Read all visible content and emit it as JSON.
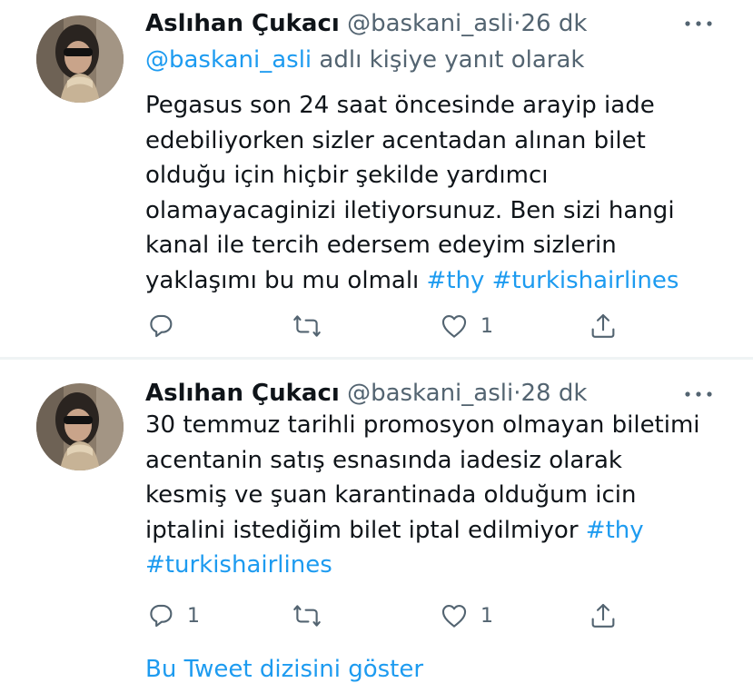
{
  "colors": {
    "link": "#1d9bf0",
    "secondary": "#536471",
    "text": "#0f1419",
    "divider": "#eff3f4"
  },
  "tweets": [
    {
      "name": "Aslıhan Çukacı",
      "handle": "@baskani_asli",
      "dot": "·",
      "time": "26 dk",
      "reply_to_mention": "@baskani_asli",
      "reply_to_suffix": "adlı kişiye yanıt olarak",
      "lines": [
        "Pegasus son 24 saat öncesinde arayip iade",
        "edebiliyorken sizler acentadan alınan bilet",
        "olduğu için hiçbir şekilde yardımcı",
        "olamayacaginizi iletiyorsunuz. Ben sizi hangi",
        "kanal ile tercih edersem edeyim sizlerin",
        "yaklaşımı bu mu olmalı"
      ],
      "hashtags": [
        "#thy",
        "#turkishairlines"
      ],
      "reply_count": "",
      "retweet_count": "",
      "like_count": "1",
      "icons": {
        "more": "more-icon",
        "reply": "reply-icon",
        "retweet": "retweet-icon",
        "like": "heart-icon",
        "share": "share-icon"
      }
    },
    {
      "name": "Aslıhan Çukacı",
      "handle": "@baskani_asli",
      "dot": "·",
      "time": "28 dk",
      "lines": [
        "30 temmuz tarihli promosyon olmayan biletimi",
        "acentanin satış esnasında iadesiz olarak",
        "kesmiş ve şuan karantinada olduğum icin",
        "iptalini istediğim bilet iptal edilmiyor"
      ],
      "hashtags": [
        "#thy",
        "#turkishairlines"
      ],
      "reply_count": "1",
      "retweet_count": "",
      "like_count": "1"
    }
  ],
  "show_more": "Bu Tweet dizisini göster"
}
